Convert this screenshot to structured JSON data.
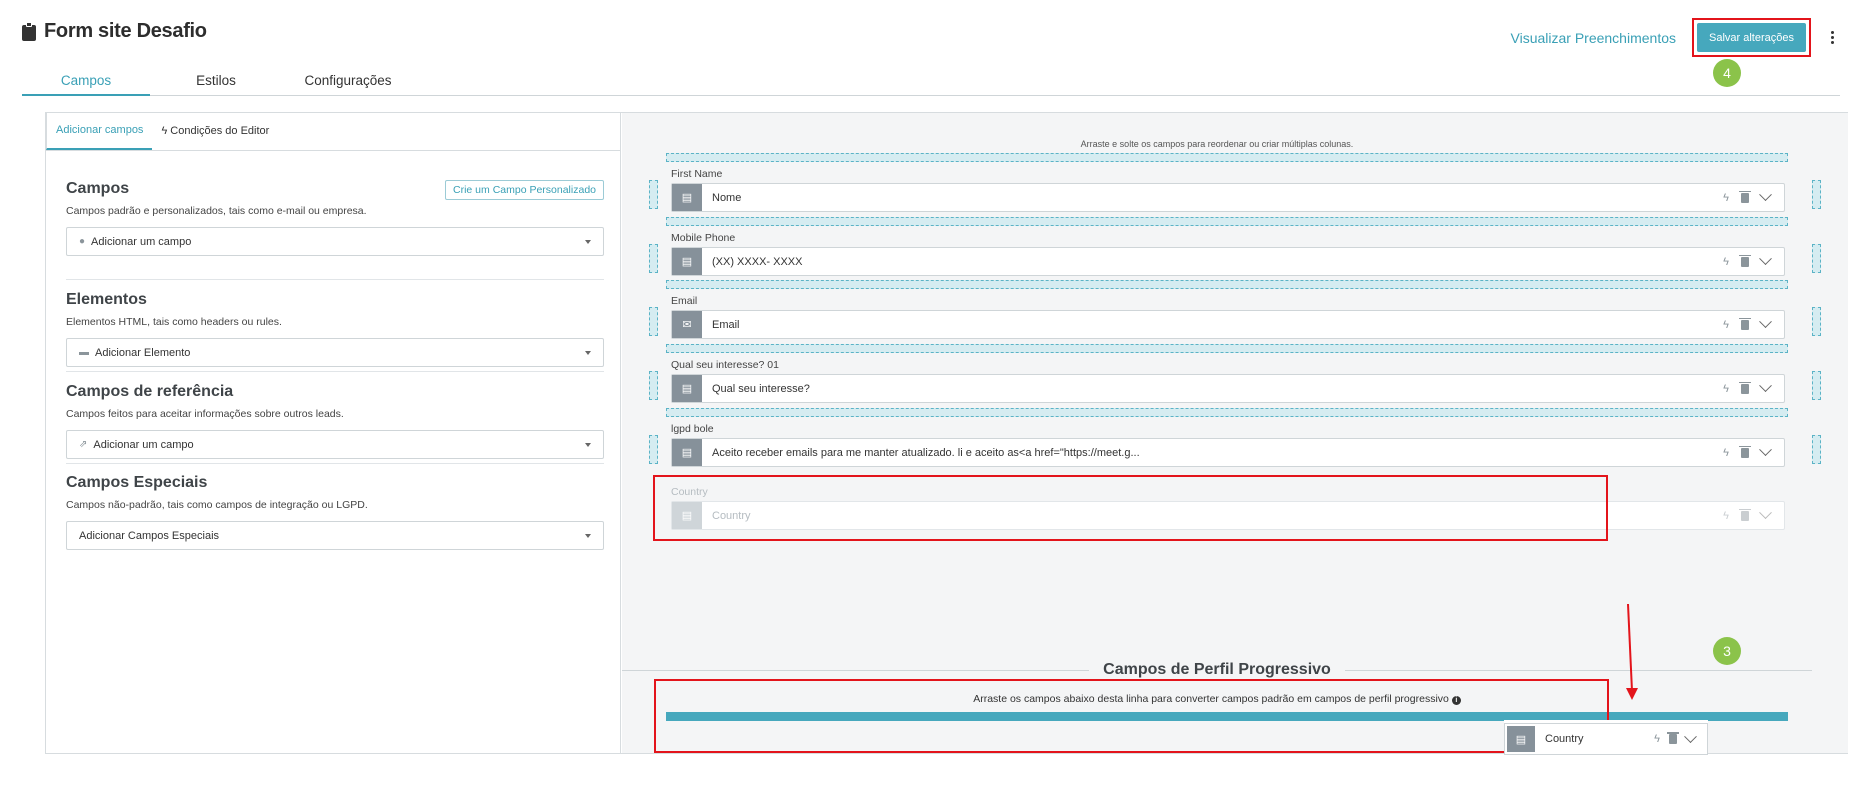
{
  "header": {
    "title": "Form site Desafio",
    "view_link": "Visualizar Preenchimentos",
    "save_label": "Salvar alterações"
  },
  "steps": {
    "save_step": "4",
    "drag_step": "3"
  },
  "tabs": [
    {
      "label": "Campos",
      "active": true
    },
    {
      "label": "Estilos",
      "active": false
    },
    {
      "label": "Configurações",
      "active": false
    }
  ],
  "left_panel": {
    "tabs": [
      {
        "label": "Adicionar campos",
        "active": true
      },
      {
        "label": "Condições do Editor",
        "active": false
      }
    ],
    "sections": [
      {
        "title": "Campos",
        "description": "Campos padrão e personalizados, tais como e-mail ou empresa.",
        "select_label": "Adicionar um campo",
        "icon": "person-icon",
        "button": "Crie um Campo Personalizado"
      },
      {
        "title": "Elementos",
        "description": "Elementos HTML, tais como headers ou rules.",
        "select_label": "Adicionar Elemento",
        "icon": "element-icon"
      },
      {
        "title": "Campos de referência",
        "description": "Campos feitos para aceitar informações sobre outros leads.",
        "select_label": "Adicionar um campo",
        "icon": "share-icon"
      },
      {
        "title": "Campos Especiais",
        "description": "Campos não-padrão, tais como campos de integração ou LGPD.",
        "select_label": "Adicionar Campos Especiais"
      }
    ]
  },
  "canvas": {
    "hint": "Arraste e solte os campos para reordenar ou criar múltiplas colunas.",
    "fields": [
      {
        "label": "First Name",
        "value": "Nome",
        "icon": "field-id-icon"
      },
      {
        "label": "Mobile Phone",
        "value": "(XX) XXXX- XXXX",
        "icon": "field-id-icon"
      },
      {
        "label": "Email",
        "value": "Email",
        "icon": "envelope-icon"
      },
      {
        "label": "Qual seu interesse? 01",
        "value": "Qual seu interesse?",
        "icon": "field-id-icon"
      },
      {
        "label": "lgpd bole",
        "value": "Aceito receber emails para me manter atualizado. li e aceito as<a href=\"https://meet.g...",
        "icon": "field-id-icon"
      }
    ],
    "ghost_field": {
      "label": "Country",
      "value": "Country"
    },
    "progressive": {
      "title": "Campos de Perfil Progressivo",
      "hint": "Arraste os campos abaixo desta linha para converter campos padrão em campos de perfil progressivo",
      "drag_card": "Country"
    }
  },
  "colors": {
    "accent": "#46a8bd",
    "highlight": "#e3141b",
    "step_badge": "#8bc34a"
  }
}
